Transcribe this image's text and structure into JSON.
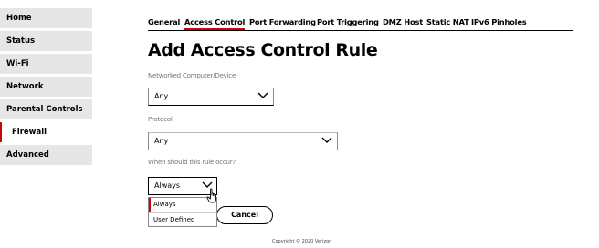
{
  "sidebar": {
    "items": [
      {
        "label": "Home"
      },
      {
        "label": "Status"
      },
      {
        "label": "Wi-Fi"
      },
      {
        "label": "Network"
      },
      {
        "label": "Parental Controls"
      },
      {
        "label": "Firewall"
      },
      {
        "label": "Advanced"
      }
    ],
    "active": "Firewall"
  },
  "tabs": {
    "items": [
      {
        "label": "General"
      },
      {
        "label": "Access Control"
      },
      {
        "label": "Port Forwarding"
      },
      {
        "label": "Port Triggering"
      },
      {
        "label": "DMZ Host"
      },
      {
        "label": "Static NAT"
      },
      {
        "label": "IPv6 Pinholes"
      }
    ],
    "active": "Access Control"
  },
  "page": {
    "title": "Add Access Control Rule"
  },
  "form": {
    "device": {
      "label": "Networked Computer/Device",
      "value": "Any"
    },
    "protocol": {
      "label": "Protocol",
      "value": "Any"
    },
    "schedule": {
      "label": "When should this rule occur?",
      "value": "Always",
      "options": [
        "Always",
        "User Defined"
      ],
      "expanded": true
    }
  },
  "buttons": {
    "cancel": "Cancel"
  },
  "footer": {
    "copyright": "Copyright © 2020 Verizon"
  },
  "colors": {
    "accent": "#cd040b",
    "sidebar_bg": "#e6e6e6"
  },
  "icons": {
    "select_arrow": "chevron-down-icon",
    "cursor": "hand-pointer-icon"
  }
}
